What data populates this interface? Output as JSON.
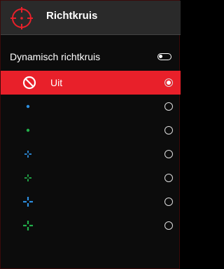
{
  "header": {
    "title": "Richtkruis",
    "icon": "crosshair-icon",
    "accent": "#e8202a"
  },
  "dynamic_toggle": {
    "label": "Dynamisch richtkruis",
    "on": false
  },
  "options": [
    {
      "label": "Uit",
      "icon": "no-entry-icon",
      "selected": true
    },
    {
      "label": "",
      "icon": "dot-blue-icon",
      "color": "#2d8fe0",
      "selected": false
    },
    {
      "label": "",
      "icon": "dot-green-icon",
      "color": "#22b04a",
      "selected": false
    },
    {
      "label": "",
      "icon": "small-cross-blue-icon",
      "color": "#2d8fe0",
      "selected": false
    },
    {
      "label": "",
      "icon": "small-cross-green-icon",
      "color": "#22b04a",
      "selected": false
    },
    {
      "label": "",
      "icon": "cross-blue-icon",
      "color": "#2d8fe0",
      "selected": false
    },
    {
      "label": "",
      "icon": "cross-green-icon",
      "color": "#22b04a",
      "selected": false
    }
  ]
}
